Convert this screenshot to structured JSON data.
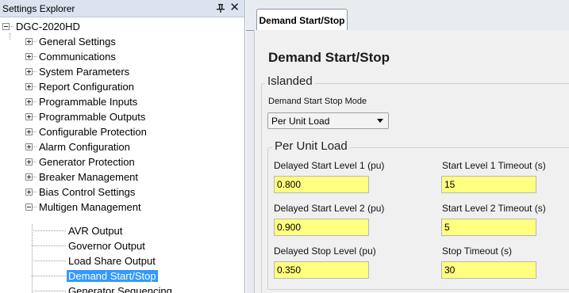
{
  "explorer": {
    "title": "Settings Explorer",
    "root": "DGC-2020HD",
    "items": [
      {
        "label": "General Settings"
      },
      {
        "label": "Communications"
      },
      {
        "label": "System Parameters"
      },
      {
        "label": "Report Configuration"
      },
      {
        "label": "Programmable Inputs"
      },
      {
        "label": "Programmable Outputs"
      },
      {
        "label": "Configurable Protection"
      },
      {
        "label": "Alarm Configuration"
      },
      {
        "label": "Generator Protection"
      },
      {
        "label": "Breaker Management"
      },
      {
        "label": "Bias Control Settings"
      },
      {
        "label": "Multigen Management"
      }
    ],
    "children": [
      {
        "label": "AVR Output"
      },
      {
        "label": "Governor Output"
      },
      {
        "label": "Load Share Output"
      },
      {
        "label": "Demand Start/Stop"
      },
      {
        "label": "Generator Sequencing"
      }
    ],
    "selected": "Demand Start/Stop"
  },
  "tab": {
    "label": "Demand Start/Stop"
  },
  "page": {
    "title": "Demand Start/Stop",
    "islanded": {
      "title": "Islanded",
      "mode_label": "Demand Start Stop Mode",
      "mode_value": "Per Unit Load"
    },
    "per_unit": {
      "title": "Per Unit Load",
      "fields": {
        "start1": {
          "label": "Delayed Start Level 1 (pu)",
          "value": "0.800"
        },
        "timeout1": {
          "label": "Start Level 1 Timeout (s)",
          "value": "15"
        },
        "start2": {
          "label": "Delayed Start Level 2 (pu)",
          "value": "0.900"
        },
        "timeout2": {
          "label": "Start Level 2 Timeout (s)",
          "value": "5"
        },
        "stop": {
          "label": "Delayed Stop Level (pu)",
          "value": "0.350"
        },
        "stop_timeout": {
          "label": "Stop Timeout (s)",
          "value": "30"
        }
      }
    }
  },
  "colors": {
    "highlight_field": "#ffff80",
    "selection": "#3399ff"
  }
}
